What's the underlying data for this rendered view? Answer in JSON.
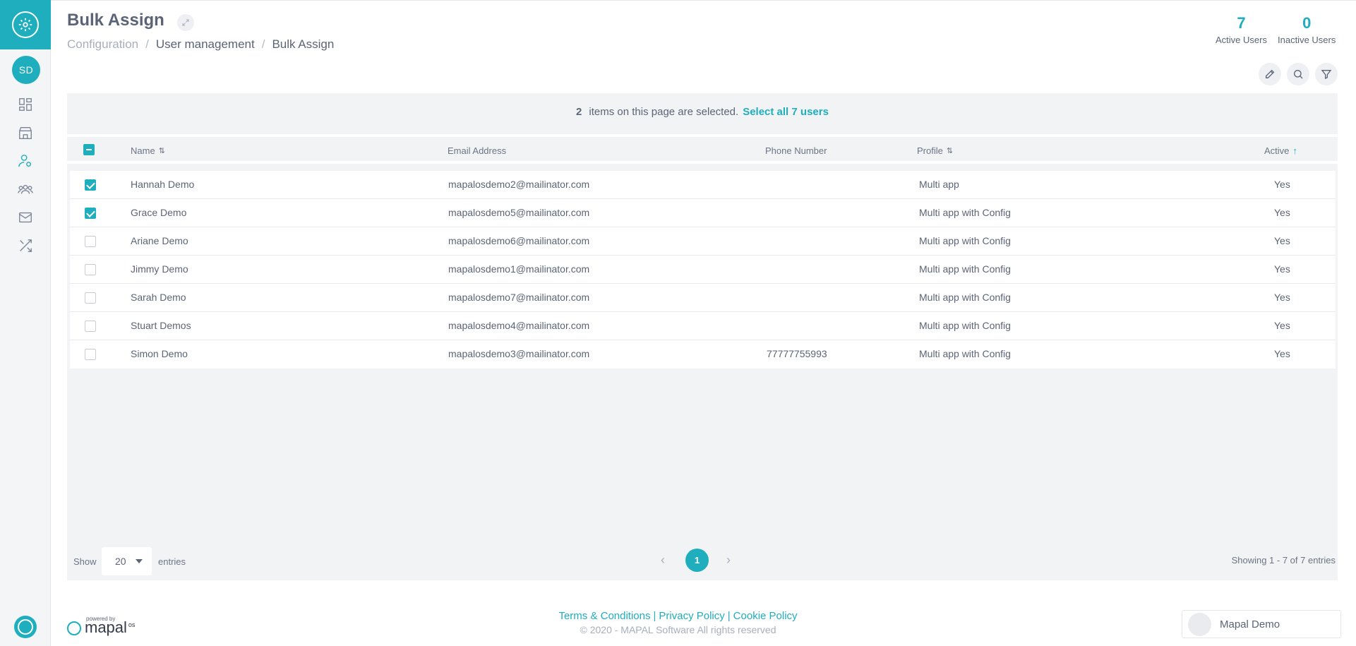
{
  "header": {
    "title": "Bulk Assign",
    "breadcrumb": [
      "Configuration",
      "User management",
      "Bulk Assign"
    ],
    "stats": [
      {
        "value": "7",
        "label": "Active Users"
      },
      {
        "value": "0",
        "label": "Inactive Users"
      }
    ]
  },
  "sidebar": {
    "avatar_initials": "SD",
    "items": [
      {
        "icon": "dashboard-icon"
      },
      {
        "icon": "store-icon"
      },
      {
        "icon": "user-settings-icon"
      },
      {
        "icon": "team-icon"
      },
      {
        "icon": "mail-icon"
      },
      {
        "icon": "shuffle-icon"
      }
    ]
  },
  "selection": {
    "count": "2",
    "text": "items on this page are selected.",
    "select_all_link": "Select all 7 users"
  },
  "table": {
    "columns": [
      "Name",
      "Email Address",
      "Phone Number",
      "Profile",
      "Active"
    ],
    "rows": [
      {
        "name": "Hannah Demo",
        "email": "mapalosdemo2@mailinator.com",
        "phone": "",
        "profile": "Multi app",
        "active": "Yes",
        "checked": true
      },
      {
        "name": "Grace Demo",
        "email": "mapalosdemo5@mailinator.com",
        "phone": "",
        "profile": "Multi app with Config",
        "active": "Yes",
        "checked": true
      },
      {
        "name": "Ariane Demo",
        "email": "mapalosdemo6@mailinator.com",
        "phone": "",
        "profile": "Multi app with Config",
        "active": "Yes",
        "checked": false
      },
      {
        "name": "Jimmy Demo",
        "email": "mapalosdemo1@mailinator.com",
        "phone": "",
        "profile": "Multi app with Config",
        "active": "Yes",
        "checked": false
      },
      {
        "name": "Sarah Demo",
        "email": "mapalosdemo7@mailinator.com",
        "phone": "",
        "profile": "Multi app with Config",
        "active": "Yes",
        "checked": false
      },
      {
        "name": "Stuart Demos",
        "email": "mapalosdemo4@mailinator.com",
        "phone": "",
        "profile": "Multi app with Config",
        "active": "Yes",
        "checked": false
      },
      {
        "name": "Simon Demo",
        "email": "mapalosdemo3@mailinator.com",
        "phone": "77777755993",
        "profile": "Multi app with Config",
        "active": "Yes",
        "checked": false
      }
    ]
  },
  "pagination": {
    "show_label": "Show",
    "page_size": "20",
    "entries_label": "entries",
    "current_page": "1",
    "showing_text": "Showing 1 - 7 of 7 entries"
  },
  "footer": {
    "powered_by": "powered by",
    "brand": "mapal",
    "brand_suffix": "os",
    "links": [
      "Terms & Conditions",
      "Privacy Policy",
      "Cookie Policy"
    ],
    "copyright": "© 2020 - MAPAL Software All rights reserved",
    "user_name": "Mapal Demo"
  },
  "colors": {
    "accent": "#1eaebe",
    "text": "#5b6476",
    "panel": "#f2f3f5"
  }
}
